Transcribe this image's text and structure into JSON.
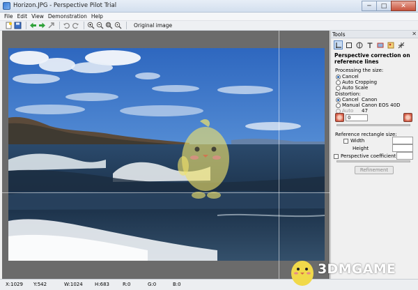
{
  "window": {
    "title": "Horizon.JPG - Perspective Pilot Trial",
    "minimize": "─",
    "maximize": "□",
    "close": "✕"
  },
  "menu": [
    "File",
    "Edit",
    "View",
    "Demonstration",
    "Help"
  ],
  "toolbar": {
    "icons": [
      "new-icon",
      "save-icon",
      "back-arrow-icon",
      "forward-arrow-icon",
      "export-icon",
      "undo-icon",
      "redo-icon",
      "zoom-in-icon",
      "zoom-out-icon",
      "zoom-fit-icon",
      "zoom-actual-icon"
    ],
    "original_image_label": "Original image"
  },
  "tools_panel": {
    "title": "Tools",
    "close": "✕",
    "section_title": "Perspective correction on reference lines",
    "processing_label": "Processing the size:",
    "processing_options": [
      {
        "label": "Cancel",
        "selected": true
      },
      {
        "label": "Auto Cropping",
        "selected": false
      },
      {
        "label": "Auto Scale",
        "selected": false
      }
    ],
    "distortion_label": "Distortion:",
    "distortion_options": [
      {
        "label": "Cancel",
        "selected": true,
        "value": "Canon"
      },
      {
        "label": "Manual",
        "selected": false,
        "value": "Canon EOS 40D"
      },
      {
        "label": "Auto",
        "selected": false,
        "value": "47"
      }
    ],
    "distortion_value": "0",
    "reference_size_label": "Reference rectangle size:",
    "width_label": "Width",
    "height_label": "Height",
    "perspective_coefficient_label": "Perspective coefficient",
    "refinement_button": "Refinement"
  },
  "status": {
    "x": "X:1029",
    "y": "Y:542",
    "w": "W:1024",
    "h": "H:683",
    "r": "R:0",
    "g": "G:0",
    "b": "B:0"
  },
  "watermark": "3DMGAME",
  "colors": {
    "titlebar": "#d3dfee",
    "canvas_bg": "#6b6b6b",
    "sky_top": "#2f6cc4",
    "sea": "#1f3550",
    "mascot": "#f1e26a"
  }
}
